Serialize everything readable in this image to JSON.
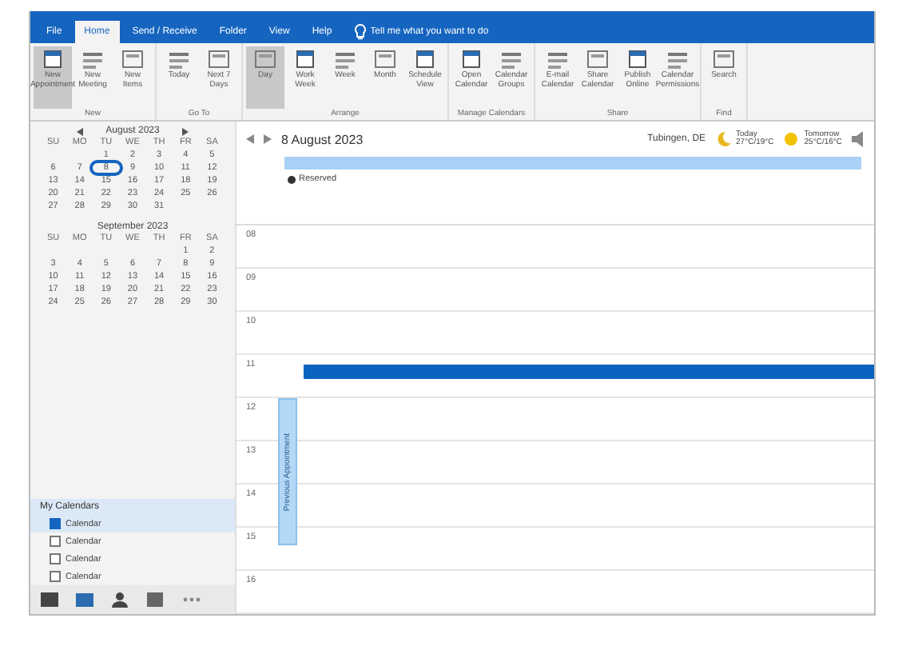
{
  "menu_tabs": [
    {
      "label": "File",
      "selected": false
    },
    {
      "label": "Home",
      "selected": true
    },
    {
      "label": "Send / Receive",
      "selected": false
    },
    {
      "label": "Folder",
      "selected": false
    },
    {
      "label": "View",
      "selected": false
    },
    {
      "label": "Help",
      "selected": false
    }
  ],
  "tell_me": {
    "placeholder": "Tell me what you want to do"
  },
  "ribbon_groups": [
    {
      "label": "New",
      "buttons": [
        {
          "label": "New Appointment",
          "selected": true
        },
        {
          "label": "New Meeting",
          "selected": false
        },
        {
          "label": "New Items",
          "selected": false
        }
      ]
    },
    {
      "label": "Go To",
      "buttons": [
        {
          "label": "Today",
          "selected": false
        },
        {
          "label": "Next 7 Days",
          "selected": false
        }
      ]
    },
    {
      "label": "Arrange",
      "buttons": [
        {
          "label": "Day",
          "selected": true
        },
        {
          "label": "Work Week",
          "selected": false
        },
        {
          "label": "Week",
          "selected": false
        },
        {
          "label": "Month",
          "selected": false
        },
        {
          "label": "Schedule View",
          "selected": false
        }
      ]
    },
    {
      "label": "Manage Calendars",
      "buttons": [
        {
          "label": "Open Calendar",
          "selected": false
        },
        {
          "label": "Calendar Groups",
          "selected": false
        }
      ]
    },
    {
      "label": "Share",
      "buttons": [
        {
          "label": "E-mail Calendar",
          "selected": false
        },
        {
          "label": "Share Calendar",
          "selected": false
        },
        {
          "label": "Publish Online",
          "selected": false
        },
        {
          "label": "Calendar Permissions",
          "selected": false
        }
      ]
    },
    {
      "label": "Find",
      "buttons": [
        {
          "label": "Search",
          "selected": false
        }
      ]
    }
  ],
  "mini_calendars": [
    {
      "title": "August 2023",
      "weekdays": [
        "SU",
        "MO",
        "TU",
        "WE",
        "TH",
        "FR",
        "SA"
      ],
      "weeks": [
        [
          {
            "day": "1",
            "selected": false
          },
          {
            "day": "2",
            "selected": false
          },
          {
            "day": "3",
            "selected": false
          },
          {
            "day": "4",
            "selected": false
          },
          {
            "day": "5",
            "selected": false
          }
        ],
        [
          {
            "day": "6",
            "selected": false
          },
          {
            "day": "7",
            "selected": false
          },
          {
            "day": "8",
            "selected": true
          },
          {
            "day": "9",
            "selected": false
          },
          {
            "day": "10",
            "selected": false
          },
          {
            "day": "11",
            "selected": false
          },
          {
            "day": "12",
            "selected": false
          }
        ],
        [
          {
            "day": "13",
            "selected": false
          },
          {
            "day": "14",
            "selected": false
          },
          {
            "day": "15",
            "selected": false
          },
          {
            "day": "16",
            "selected": false
          },
          {
            "day": "17",
            "selected": false
          },
          {
            "day": "18",
            "selected": false
          },
          {
            "day": "19",
            "selected": false
          }
        ],
        [
          {
            "day": "20",
            "selected": false
          },
          {
            "day": "21",
            "selected": false
          },
          {
            "day": "22",
            "selected": false
          },
          {
            "day": "23",
            "selected": false
          },
          {
            "day": "24",
            "selected": false
          },
          {
            "day": "25",
            "selected": false
          },
          {
            "day": "26",
            "selected": false
          }
        ],
        [
          {
            "day": "27",
            "selected": false
          },
          {
            "day": "28",
            "selected": false
          },
          {
            "day": "29",
            "selected": false
          },
          {
            "day": "30",
            "selected": false
          },
          {
            "day": "31",
            "selected": false
          }
        ]
      ]
    },
    {
      "title": "September 2023",
      "weekdays": [
        "SU",
        "MO",
        "TU",
        "WE",
        "TH",
        "FR",
        "SA"
      ],
      "weeks": [
        [
          {
            "day": "1",
            "selected": false
          },
          {
            "day": "2",
            "selected": false
          }
        ],
        [
          {
            "day": "3",
            "selected": false
          },
          {
            "day": "4",
            "selected": false
          },
          {
            "day": "5",
            "selected": false
          },
          {
            "day": "6",
            "selected": false
          },
          {
            "day": "7",
            "selected": false
          },
          {
            "day": "8",
            "selected": false
          },
          {
            "day": "9",
            "selected": false
          }
        ],
        [
          {
            "day": "10",
            "selected": false
          },
          {
            "day": "11",
            "selected": false
          },
          {
            "day": "12",
            "selected": false
          },
          {
            "day": "13",
            "selected": false
          },
          {
            "day": "14",
            "selected": false
          },
          {
            "day": "15",
            "selected": false
          },
          {
            "day": "16",
            "selected": false
          }
        ],
        [
          {
            "day": "17",
            "selected": false
          },
          {
            "day": "18",
            "selected": false
          },
          {
            "day": "19",
            "selected": false
          },
          {
            "day": "20",
            "selected": false
          },
          {
            "day": "21",
            "selected": false
          },
          {
            "day": "22",
            "selected": false
          },
          {
            "day": "23",
            "selected": false
          }
        ],
        [
          {
            "day": "24",
            "selected": false
          },
          {
            "day": "25",
            "selected": false
          },
          {
            "day": "26",
            "selected": false
          },
          {
            "day": "27",
            "selected": false
          },
          {
            "day": "28",
            "selected": false
          },
          {
            "day": "29",
            "selected": false
          },
          {
            "day": "30",
            "selected": false
          }
        ]
      ]
    }
  ],
  "calendar_list": {
    "title": "My Calendars",
    "items": [
      {
        "label": "Calendar",
        "checked": true,
        "selected": true
      },
      {
        "label": "Calendar",
        "checked": false,
        "selected": false
      },
      {
        "label": "Calendar",
        "checked": false,
        "selected": false
      },
      {
        "label": "Calendar",
        "checked": false,
        "selected": false
      }
    ]
  },
  "date_title": "8 August 2023",
  "location": "Tubingen, DE",
  "weather": [
    {
      "day": "Today",
      "temp": "27°C/19°C"
    },
    {
      "day": "Tomorrow",
      "temp": "25°C/16°C"
    }
  ],
  "all_day_event": "Reserved",
  "hours": [
    {
      "label": "08",
      "has_event": false
    },
    {
      "label": "09",
      "has_event": false
    },
    {
      "label": "10",
      "has_event": false
    },
    {
      "label": "11",
      "has_event": true
    },
    {
      "label": "12",
      "has_event": false
    },
    {
      "label": "13",
      "has_event": false
    },
    {
      "label": "14",
      "has_event": false
    },
    {
      "label": "15",
      "has_event": false
    },
    {
      "label": "16",
      "has_event": false
    }
  ],
  "previous_appointment": "Previous Appointment"
}
